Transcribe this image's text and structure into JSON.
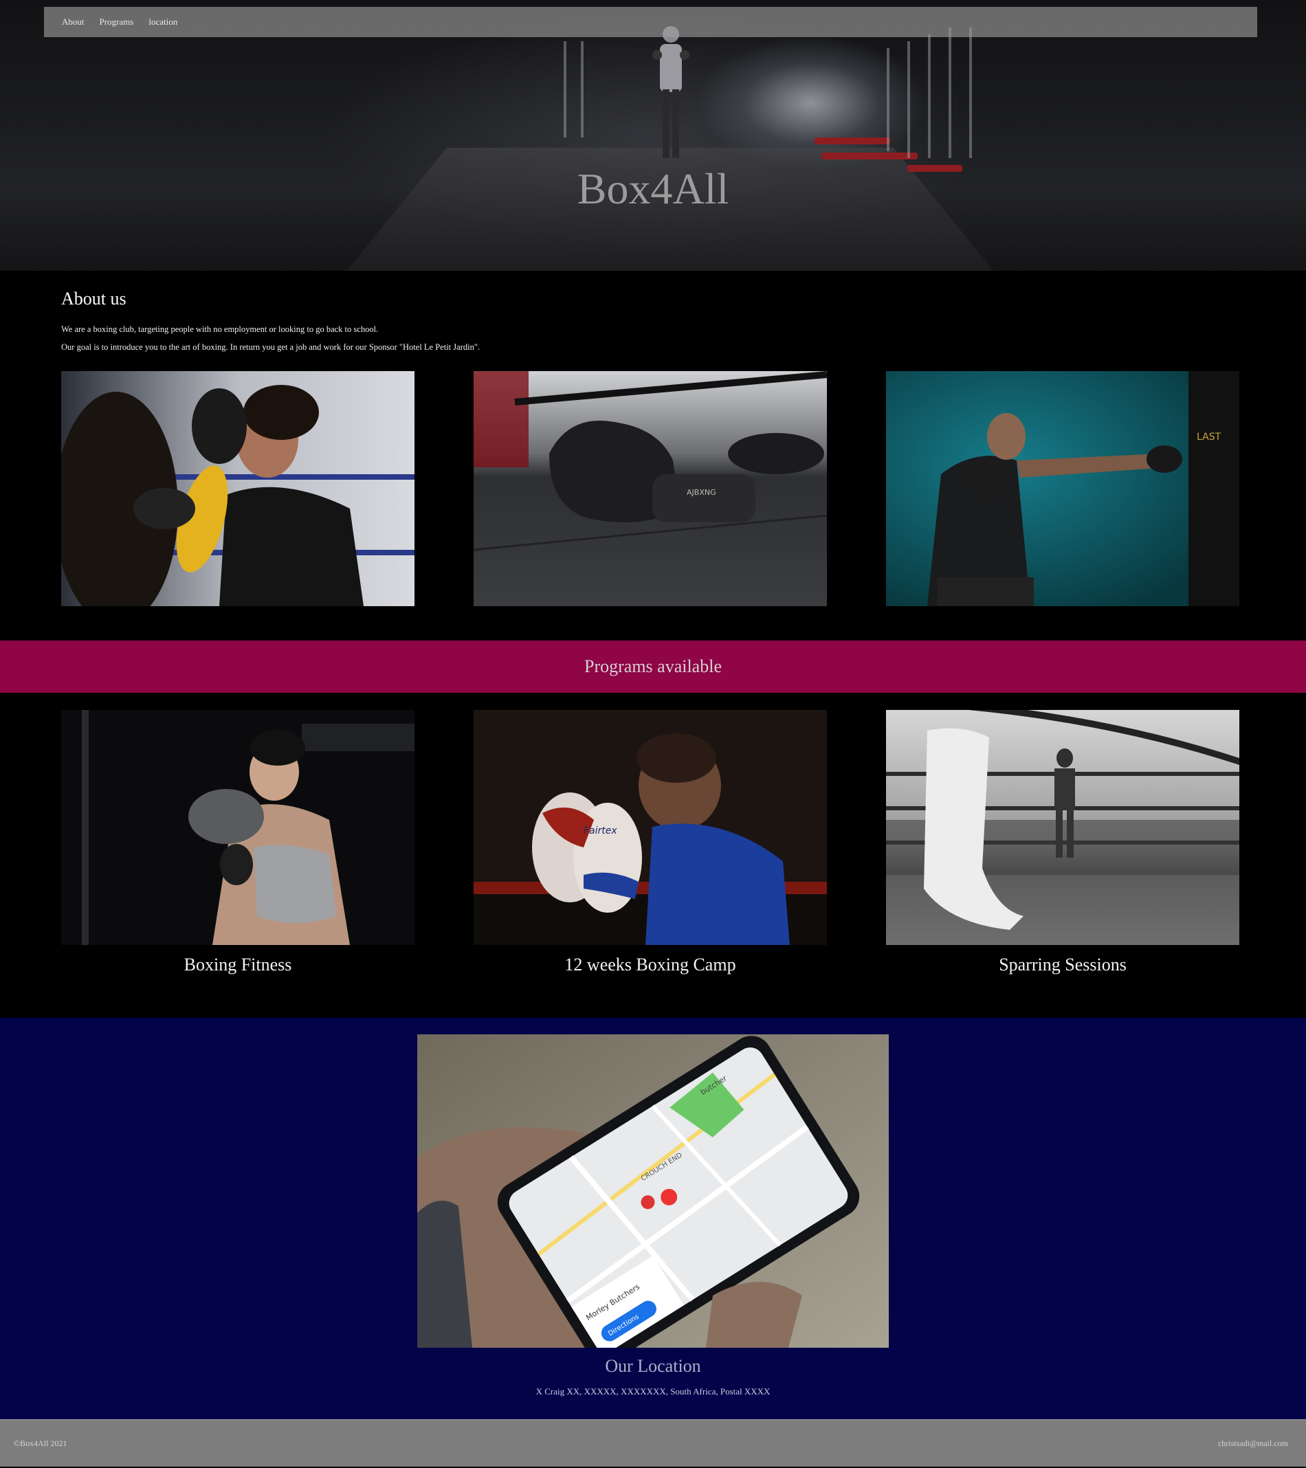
{
  "nav": {
    "items": [
      "About",
      "Programs",
      "location"
    ]
  },
  "hero": {
    "title": "Box4All"
  },
  "about": {
    "heading": "About us",
    "paragraph1": "We are a boxing club, targeting people with no employment or looking to go back to school.",
    "paragraph2": "Our goal is to introduce you to the art of boxing. In return you get a job and work for our Sponsor \"Hotel Le Petit Jardin\"."
  },
  "programs": {
    "heading": "Programs available",
    "items": [
      {
        "caption": "Boxing Fitness"
      },
      {
        "caption": "12 weeks Boxing Camp"
      },
      {
        "caption": "Sparring Sessions"
      }
    ]
  },
  "photo_text": {
    "glove_brand": "AJBXNG",
    "bag_brand": "LAST",
    "headgear_brand": "Fairtex",
    "map_search": "butcher",
    "map_shop": "Morley Butchers",
    "map_area": "CROUCH END",
    "map_directions": "Directions"
  },
  "location": {
    "heading": "Our Location",
    "address": "X Craig XX, XXXXX, XXXXXXX, South Africa, Postal XXXX"
  },
  "footer": {
    "copyright": "©Box4All 2021",
    "email": "christsadi@mail.com"
  },
  "colors": {
    "programs_band": "#8f0545",
    "location_bg": "#03034a",
    "footer_bg": "#7d7d7d",
    "nav_bg": "rgba(160,160,160,0.62)"
  }
}
